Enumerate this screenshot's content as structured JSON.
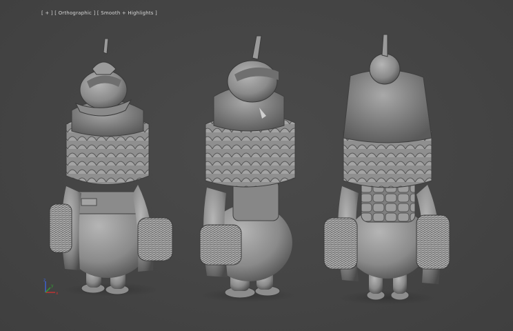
{
  "viewport": {
    "label_plus": "[ + ]",
    "label_view": "[ Orthographic ]",
    "label_shading": "[ Smooth + Highlights ]"
  },
  "axis": {
    "x": "x",
    "y": "y",
    "z": "z"
  },
  "colors": {
    "background": "#464646",
    "model": "#8e8e8e",
    "label": "#d8d8d8",
    "axis_x": "#c83232",
    "axis_y": "#32a032",
    "axis_z": "#3c64dc"
  }
}
